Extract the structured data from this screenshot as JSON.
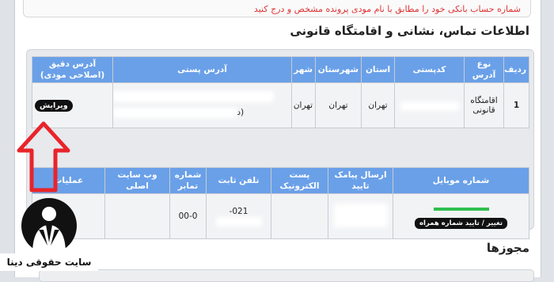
{
  "notice": {
    "text": "شماره حساب بانکی خود را مطابق با نام مودی پرونده مشخص و درج کنید"
  },
  "section_title": "اطلاعات تماس، نشانی و اقامتگاه قانونی",
  "table1": {
    "headers": [
      "ردیف",
      "نوع آدرس",
      "کدپستی",
      "استان",
      "شهرستان",
      "شهر",
      "آدرس پستی",
      "آدرس دقیق (اصلاحی مودی)"
    ],
    "row": {
      "index": "1",
      "type": "اقامتگاه قانونی",
      "province": "تهران",
      "county": "تهران",
      "city": "تهران",
      "postal_address_tail": "(د"
    },
    "edit_label": "ویرایش"
  },
  "table2": {
    "headers": [
      "شماره موبایل",
      "ارسال پیامک تایید",
      "پست الکترونیک",
      "تلفن ثابت",
      "شماره تمابر",
      "وب سایت اصلی",
      "عملیات"
    ],
    "row": {
      "phone": "021-",
      "fax": "00-0"
    },
    "mobile_button": "تغییر / تایید شماره همراه"
  },
  "permits_title": "مجوزها",
  "logo": {
    "caption": "سایت حقوقی دینا"
  },
  "colors": {
    "header_bg": "#6aa0e8",
    "arrow": "#e8242a",
    "notice": "#e03333",
    "mobile_ok": "#2fbf4d"
  }
}
